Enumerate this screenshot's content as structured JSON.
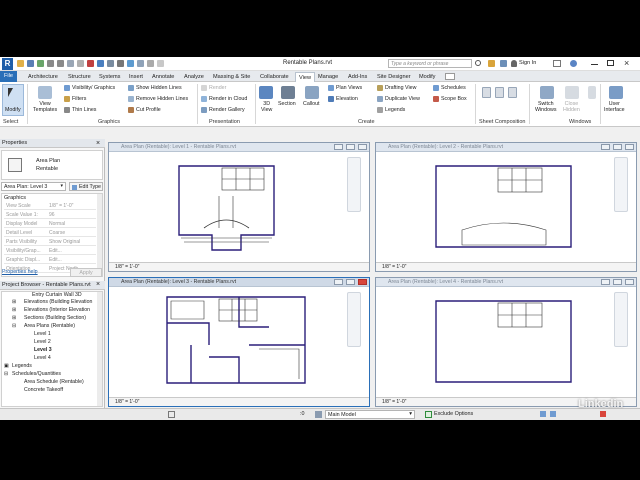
{
  "window_title": "Rentable Plans.rvt",
  "search_placeholder": "Type a keyword or phrase",
  "sign_in": "Sign In",
  "tabs": [
    "File",
    "Architecture",
    "Structure",
    "Systems",
    "Insert",
    "Annotate",
    "Analyze",
    "Massing & Site",
    "Collaborate",
    "View",
    "Manage",
    "Add-Ins",
    "Site Designer",
    "Modify"
  ],
  "active_tab": "View",
  "ribbon": {
    "modify": "Modify",
    "select": "Select",
    "view_templates": "View\nTemplates",
    "graphics_items": [
      "Visibility/ Graphics",
      "Filters",
      "Thin  Lines"
    ],
    "show_items": [
      "Show  Hidden Lines",
      "Remove  Hidden Lines",
      "Cut  Profile"
    ],
    "graphics_title": "Graphics",
    "render_items": [
      "Render",
      "Render  in Cloud",
      "Render  Gallery"
    ],
    "presentation_title": "Presentation",
    "view3d": "3D\nView",
    "section": "Section",
    "callout": "Callout",
    "create_col1": [
      "Plan  Views",
      "Elevation",
      ""
    ],
    "create_col2": [
      "Drafting  View",
      "Duplicate  View",
      "Legends"
    ],
    "create_col3": [
      "Schedules",
      "Scope  Box",
      ""
    ],
    "create_title": "Create",
    "sheet_title": "Sheet Composition",
    "switch_windows": "Switch\nWindows",
    "close_hidden": "Close\nHidden",
    "replicate": "Replicate",
    "windows_title": "Windows",
    "user_interface": "User\nInterface"
  },
  "properties": {
    "title": "Properties",
    "type_name": "Area Plan",
    "type_sub": "Rentable",
    "selector": "Area Plan: Level 3",
    "edit_type": "Edit Type",
    "group": "Graphics",
    "rows": [
      {
        "k": "View Scale",
        "v": "1/8\" = 1'-0\""
      },
      {
        "k": "Scale Value    1:",
        "v": "96"
      },
      {
        "k": "Display Model",
        "v": "Normal"
      },
      {
        "k": "Detail Level",
        "v": "Coarse"
      },
      {
        "k": "Parts Visibility",
        "v": "Show Original"
      },
      {
        "k": "Visibility/Grap...",
        "v": "Edit..."
      },
      {
        "k": "Graphic Displ...",
        "v": "Edit..."
      },
      {
        "k": "Orientation",
        "v": "Project North"
      }
    ],
    "help_link": "Properties help",
    "apply": "Apply"
  },
  "project_browser": {
    "title": "Project Browser - Rentable Plans.rvt",
    "items": [
      "Entry Curtain Wall 3D",
      "Elevations (Building Elevation",
      "Elevations (Interior Elevation",
      "Sections (Building Section)",
      "Area Plans (Rentable)",
      "Level 1",
      "Level 2",
      "Level 3",
      "Level 4",
      "Legends",
      "Schedules/Quantities",
      "Area Schedule (Rentable)",
      "Concrete Takeoff"
    ]
  },
  "views": [
    {
      "title": "Area Plan (Rentable): Level 1 - Rentable Plans.rvt",
      "scale": "1/8\" = 1'-0\""
    },
    {
      "title": "Area Plan (Rentable): Level 2 - Rentable Plans.rvt",
      "scale": "1/8\" = 1'-0\""
    },
    {
      "title": "Area Plan (Rentable): Level 3 - Rentable Plans.rvt",
      "scale": "1/8\" = 1'-0\""
    },
    {
      "title": "Area Plan (Rentable): Level 4 - Rentable Plans.rvt",
      "scale": "1/8\" = 1'-0\""
    }
  ],
  "statusbar": {
    "coord": ":0",
    "model": "Main Model",
    "exclude": "Exclude Options"
  },
  "watermark": "Linkedin",
  "colors": {
    "file_tab": "#2a6fb8",
    "wall": "#3a2a8c",
    "close_red": "#d9453b"
  }
}
